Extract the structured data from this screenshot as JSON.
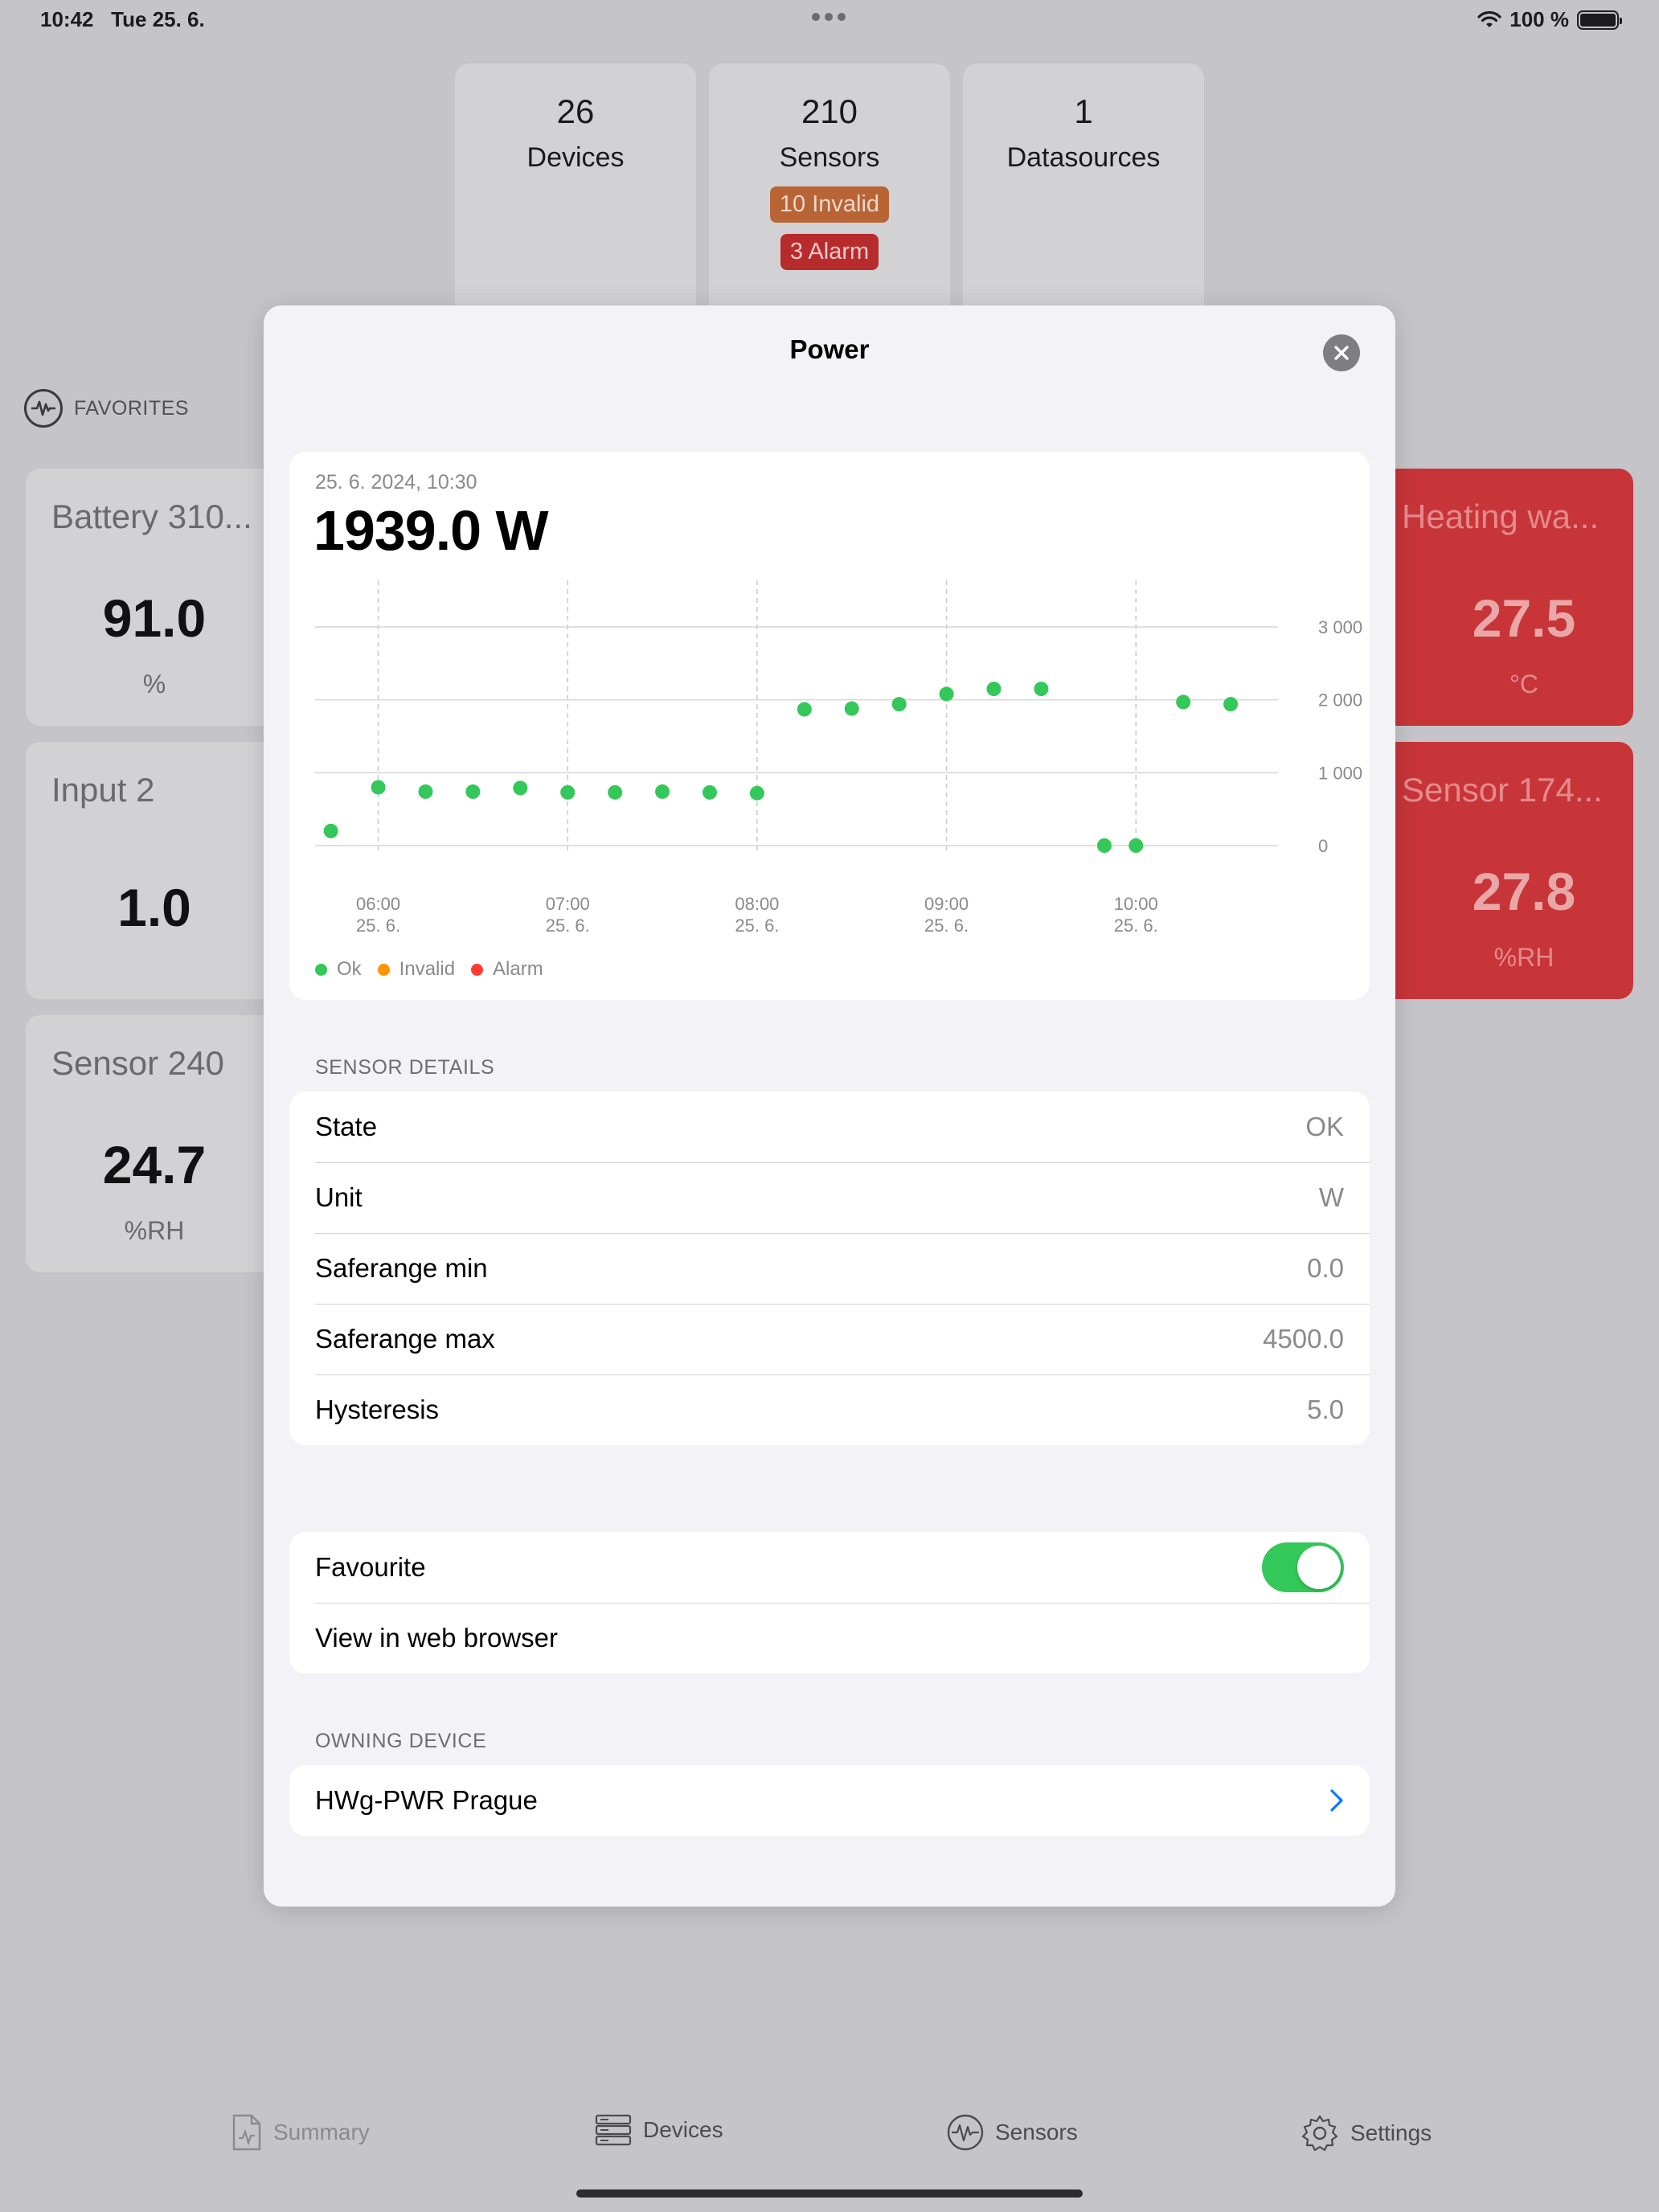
{
  "status_bar": {
    "time": "10:42",
    "date": "Tue 25. 6.",
    "battery": "100 %"
  },
  "summary": {
    "devices": {
      "count": "26",
      "label": "Devices"
    },
    "sensors": {
      "count": "210",
      "label": "Sensors",
      "invalid_badge": "10 Invalid",
      "alarm_badge": "3 Alarm"
    },
    "datasources": {
      "count": "1",
      "label": "Datasources"
    }
  },
  "favorites": {
    "label": "FAVORITES",
    "tiles_left": [
      {
        "title": "Battery 310...",
        "value": "91.0",
        "unit": "%"
      },
      {
        "title": "Input 2",
        "value": "1.0",
        "unit": ""
      },
      {
        "title": "Sensor 240",
        "value": "24.7",
        "unit": "%RH"
      }
    ],
    "tiles_right": [
      {
        "title": "Heating wa...",
        "value": "27.5",
        "unit": "°C"
      },
      {
        "title": "Sensor 174...",
        "value": "27.8",
        "unit": "%RH"
      }
    ]
  },
  "modal": {
    "title": "Power",
    "chart": {
      "timestamp": "25. 6. 2024, 10:30",
      "current_value": "1939.0 W",
      "legend": [
        {
          "label": "Ok",
          "color": "#34c759"
        },
        {
          "label": "Invalid",
          "color": "#ff9500"
        },
        {
          "label": "Alarm",
          "color": "#ff3b30"
        }
      ]
    },
    "sensor_details_label": "SENSOR DETAILS",
    "details": [
      {
        "label": "State",
        "value": "OK"
      },
      {
        "label": "Unit",
        "value": "W"
      },
      {
        "label": "Saferange min",
        "value": "0.0"
      },
      {
        "label": "Saferange max",
        "value": "4500.0"
      },
      {
        "label": "Hysteresis",
        "value": "5.0"
      }
    ],
    "favourite_label": "Favourite",
    "favourite_on": true,
    "web_link": "View in web browser",
    "owning_device_label": "OWNING DEVICE",
    "owning_device": "HWg-PWR Prague"
  },
  "tabs": [
    {
      "label": "Summary",
      "icon": "summary-doc-icon"
    },
    {
      "label": "Devices",
      "icon": "devices-rack-icon"
    },
    {
      "label": "Sensors",
      "icon": "sensors-pulse-icon"
    },
    {
      "label": "Settings",
      "icon": "gear-icon"
    }
  ],
  "chart_data": {
    "type": "scatter",
    "title": "",
    "xlabel": "",
    "ylabel": "",
    "ylim": [
      0,
      3000
    ],
    "yticks": [
      "0",
      "1 000",
      "2 000",
      "3 000"
    ],
    "xticks": [
      {
        "time": "06:00",
        "date": "25. 6.",
        "minutes": 360
      },
      {
        "time": "07:00",
        "date": "25. 6.",
        "minutes": 420
      },
      {
        "time": "08:00",
        "date": "25. 6.",
        "minutes": 480
      },
      {
        "time": "09:00",
        "date": "25. 6.",
        "minutes": 540
      },
      {
        "time": "10:00",
        "date": "25. 6.",
        "minutes": 600
      }
    ],
    "xlim_minutes": [
      340,
      645
    ],
    "grid": true,
    "legend": "bottom-left",
    "series": [
      {
        "name": "Ok",
        "color": "#34c759",
        "points": [
          {
            "minutes": 345,
            "value": 200
          },
          {
            "minutes": 360,
            "value": 800
          },
          {
            "minutes": 375,
            "value": 740
          },
          {
            "minutes": 390,
            "value": 740
          },
          {
            "minutes": 405,
            "value": 790
          },
          {
            "minutes": 420,
            "value": 730
          },
          {
            "minutes": 435,
            "value": 730
          },
          {
            "minutes": 450,
            "value": 740
          },
          {
            "minutes": 465,
            "value": 730
          },
          {
            "minutes": 480,
            "value": 720
          },
          {
            "minutes": 495,
            "value": 1870
          },
          {
            "minutes": 510,
            "value": 1880
          },
          {
            "minutes": 525,
            "value": 1940
          },
          {
            "minutes": 540,
            "value": 2080
          },
          {
            "minutes": 555,
            "value": 2150
          },
          {
            "minutes": 570,
            "value": 2150
          },
          {
            "minutes": 590,
            "value": 0
          },
          {
            "minutes": 600,
            "value": 0
          },
          {
            "minutes": 615,
            "value": 1970
          },
          {
            "minutes": 630,
            "value": 1940
          }
        ]
      }
    ]
  }
}
